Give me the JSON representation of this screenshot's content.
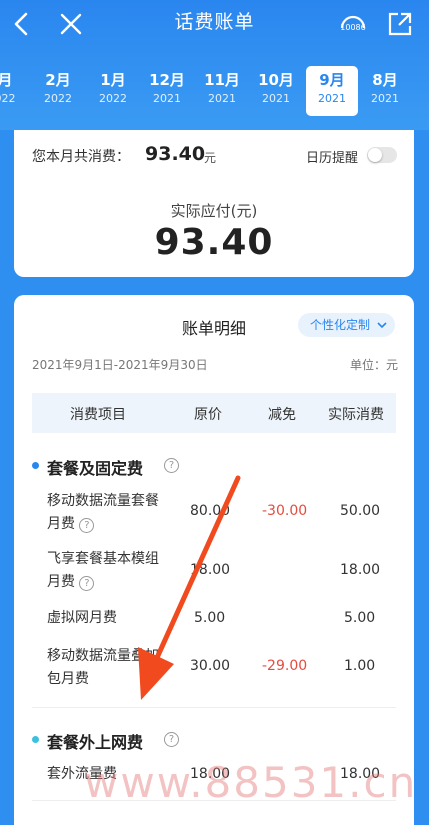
{
  "header": {
    "title": "话费账单",
    "hotline_label": "10086",
    "months": [
      {
        "month": "月",
        "year": "022"
      },
      {
        "month": "2月",
        "year": "2022"
      },
      {
        "month": "1月",
        "year": "2022"
      },
      {
        "month": "12月",
        "year": "2021"
      },
      {
        "month": "11月",
        "year": "2021"
      },
      {
        "month": "10月",
        "year": "2021"
      },
      {
        "month": "9月",
        "year": "2021",
        "active": true
      },
      {
        "month": "8月",
        "year": "2021"
      }
    ]
  },
  "summary": {
    "total_label": "您本月共消费：",
    "total_value": "93.40",
    "total_unit": "元",
    "calendar_label": "日历提醒",
    "calendar_on": false,
    "pay_label": "实际应付(元)",
    "pay_value": "93.40"
  },
  "detail": {
    "title": "账单明细",
    "custom_label": "个性化定制",
    "date_range": "2021年9月1日-2021年9月30日",
    "unit": "单位：元",
    "columns": [
      "消费项目",
      "原价",
      "减免",
      "实际消费"
    ],
    "sections": [
      {
        "title": "套餐及固定费",
        "rows": [
          {
            "name": "移动数据流量套餐月费",
            "orig": "80.00",
            "discount": "-30.00",
            "actual": "50.00"
          },
          {
            "name": "飞享套餐基本模组月费",
            "orig": "18.00",
            "discount": "",
            "actual": "18.00"
          },
          {
            "name": "虚拟网月费",
            "orig": "5.00",
            "discount": "",
            "actual": "5.00"
          },
          {
            "name": "移动数据流量叠加包月费",
            "orig": "30.00",
            "discount": "-29.00",
            "actual": "1.00"
          }
        ]
      },
      {
        "title": "套餐外上网费",
        "rows": [
          {
            "name": "套外流量费",
            "orig": "18.00",
            "discount": "",
            "actual": "18.00"
          }
        ]
      }
    ]
  },
  "watermark": "www.88531.cn",
  "colors": {
    "header": "#2a86ef",
    "discount": "#e44c3e",
    "arrow": "#f04a1e",
    "dot1": "#2a86ef",
    "dot2": "#3cc0e0"
  }
}
